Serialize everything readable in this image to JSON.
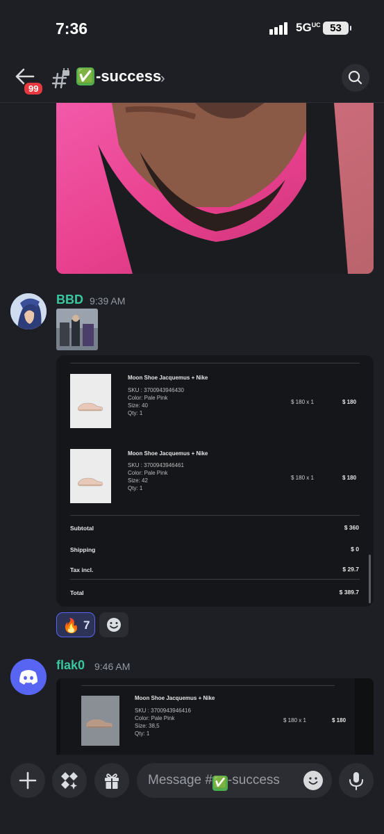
{
  "status_bar": {
    "time": "7:36",
    "network": "5G",
    "network_sup": "UC",
    "battery": "53"
  },
  "header": {
    "unread_badge": "99",
    "channel_check": "✅",
    "channel_name": "-success"
  },
  "messages": [
    {
      "username": "BBD",
      "time": "9:39 AM"
    },
    {
      "username": "flak0",
      "time": "9:46 AM"
    }
  ],
  "order_card": {
    "items": [
      {
        "name": "Moon Shoe Jacquemus + Nike",
        "sku": "SKU : 3700943946430",
        "color": "Color: Pale Pink",
        "size": "Size: 40",
        "qty": "Qty: 1",
        "unit": "$ 180 x 1",
        "total": "$ 180"
      },
      {
        "name": "Moon Shoe Jacquemus + Nike",
        "sku": "SKU : 3700943946461",
        "color": "Color: Pale Pink",
        "size": "Size: 42",
        "qty": "Qty: 1",
        "unit": "$ 180 x 1",
        "total": "$ 180"
      }
    ],
    "summary": [
      {
        "label": "Subtotal",
        "value": "$ 360"
      },
      {
        "label": "Shipping",
        "value": "$ 0"
      },
      {
        "label": "Tax incl.",
        "value": "$ 29.7"
      },
      {
        "label": "Total",
        "value": "$ 389.7"
      }
    ]
  },
  "reaction": {
    "emoji": "🔥",
    "count": "7"
  },
  "order_card_2": {
    "item": {
      "name": "Moon Shoe Jacquemus + Nike",
      "sku": "SKU : 3700943946416",
      "color": "Color: Pale Pink",
      "size": "Size: 38,5",
      "qty": "Qty: 1",
      "unit": "$ 180 x 1",
      "total": "$ 180"
    }
  },
  "composer": {
    "placeholder_prefix": "Message #",
    "placeholder_check": "✅",
    "placeholder_suffix": "-success"
  },
  "icons": [
    "back-arrow-icon",
    "hash-lock-icon",
    "chevron-right-icon",
    "search-icon",
    "plus-icon",
    "apps-icon",
    "gift-icon",
    "emoji-icon",
    "microphone-icon",
    "discord-logo-icon"
  ]
}
